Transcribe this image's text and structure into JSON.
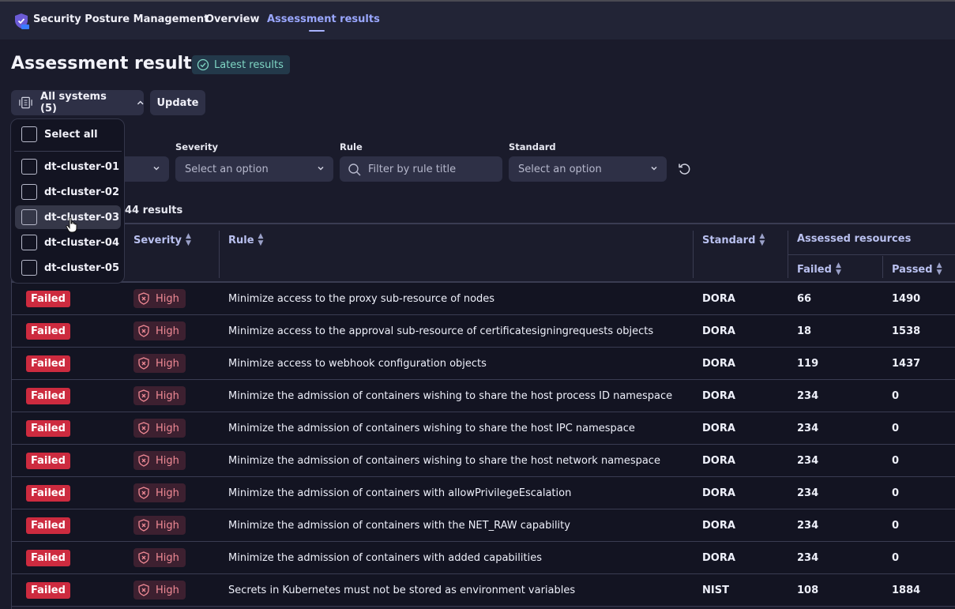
{
  "app": {
    "title": "Security Posture Management",
    "logo_badge": "SPM",
    "tabs": [
      {
        "label": "Overview",
        "active": false
      },
      {
        "label": "Assessment results",
        "active": true
      }
    ]
  },
  "page": {
    "title": "Assessment results",
    "badge": "Latest results"
  },
  "toolbar": {
    "systems_label": "All systems (5)",
    "update_label": "Update"
  },
  "systems_dropdown": {
    "select_all": "Select all",
    "items": [
      {
        "label": "dt-cluster-01",
        "checked": false
      },
      {
        "label": "dt-cluster-02",
        "checked": false
      },
      {
        "label": "dt-cluster-03",
        "checked": false,
        "hovered": true
      },
      {
        "label": "dt-cluster-04",
        "checked": false
      },
      {
        "label": "dt-cluster-05",
        "checked": false
      }
    ]
  },
  "filters": {
    "severity": {
      "label": "Severity",
      "placeholder": "Select an option"
    },
    "rule": {
      "label": "Rule",
      "placeholder": "Filter by rule title"
    },
    "standard": {
      "label": "Standard",
      "placeholder": "Select an option"
    }
  },
  "results_count": "44 results",
  "table": {
    "columns": {
      "severity": "Severity",
      "rule": "Rule",
      "standard": "Standard",
      "assessed_resources": "Assessed resources",
      "failed": "Failed",
      "passed": "Passed"
    },
    "rows": [
      {
        "status": "Failed",
        "severity": "High",
        "rule": "Minimize access to the proxy sub-resource of nodes",
        "standard": "DORA",
        "failed": "66",
        "passed": "1490"
      },
      {
        "status": "Failed",
        "severity": "High",
        "rule": "Minimize access to the approval sub-resource of certificatesigningrequests objects",
        "standard": "DORA",
        "failed": "18",
        "passed": "1538"
      },
      {
        "status": "Failed",
        "severity": "High",
        "rule": "Minimize access to webhook configuration objects",
        "standard": "DORA",
        "failed": "119",
        "passed": "1437"
      },
      {
        "status": "Failed",
        "severity": "High",
        "rule": "Minimize the admission of containers wishing to share the host process ID namespace",
        "standard": "DORA",
        "failed": "234",
        "passed": "0"
      },
      {
        "status": "Failed",
        "severity": "High",
        "rule": "Minimize the admission of containers wishing to share the host IPC namespace",
        "standard": "DORA",
        "failed": "234",
        "passed": "0"
      },
      {
        "status": "Failed",
        "severity": "High",
        "rule": "Minimize the admission of containers wishing to share the host network namespace",
        "standard": "DORA",
        "failed": "234",
        "passed": "0"
      },
      {
        "status": "Failed",
        "severity": "High",
        "rule": "Minimize the admission of containers with allowPrivilegeEscalation",
        "standard": "DORA",
        "failed": "234",
        "passed": "0"
      },
      {
        "status": "Failed",
        "severity": "High",
        "rule": "Minimize the admission of containers with the NET_RAW capability",
        "standard": "DORA",
        "failed": "234",
        "passed": "0"
      },
      {
        "status": "Failed",
        "severity": "High",
        "rule": "Minimize the admission of containers with added capabilities",
        "standard": "DORA",
        "failed": "234",
        "passed": "0"
      },
      {
        "status": "Failed",
        "severity": "High",
        "rule": "Secrets in Kubernetes must not be stored as environment variables",
        "standard": "NIST",
        "failed": "108",
        "passed": "1884"
      }
    ]
  },
  "colors": {
    "accent": "#9aa7ff",
    "failed": "#cd2b3f",
    "high_severity": "#f08a95",
    "latest_badge": "#7fd6c4"
  }
}
